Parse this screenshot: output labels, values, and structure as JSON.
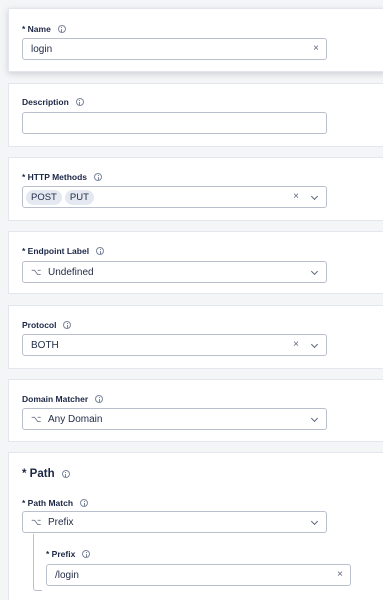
{
  "name": {
    "label": "* Name",
    "value": "login",
    "clear": "×"
  },
  "description": {
    "label": "Description",
    "value": ""
  },
  "http_methods": {
    "label": "* HTTP Methods",
    "chips": [
      "POST",
      "PUT"
    ],
    "clear": "×"
  },
  "endpoint_label": {
    "label": "* Endpoint Label",
    "value": "Undefined",
    "icon": "⌥"
  },
  "protocol": {
    "label": "Protocol",
    "value": "BOTH",
    "clear": "×"
  },
  "domain_matcher": {
    "label": "Domain Matcher",
    "value": "Any Domain",
    "icon": "⌥"
  },
  "path": {
    "title": "* Path",
    "match_label": "* Path Match",
    "match_value": "Prefix",
    "match_icon": "⌥",
    "prefix_label": "* Prefix",
    "prefix_value": "/login",
    "clear": "×"
  }
}
